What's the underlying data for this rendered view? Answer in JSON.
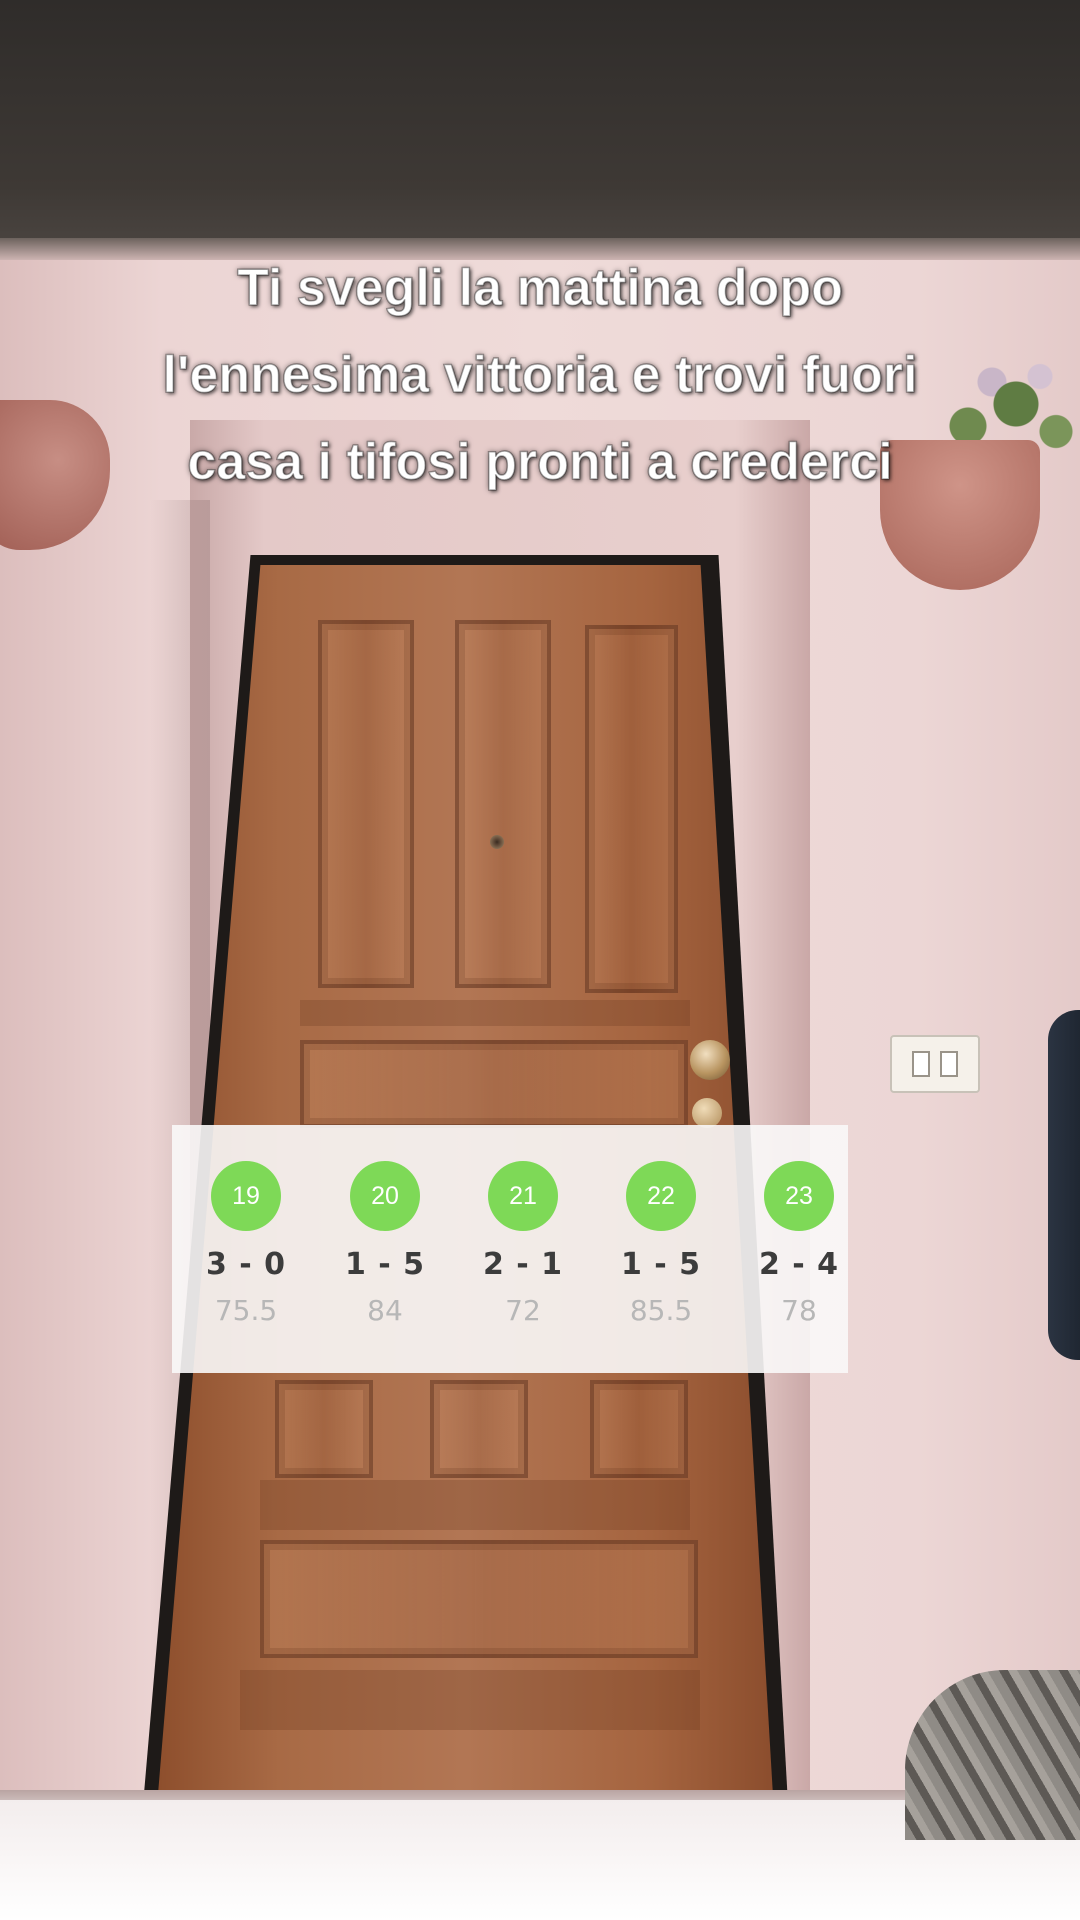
{
  "caption": {
    "lines": [
      "Ti svegli la mattina dopo",
      "l'ennesima vittoria e trovi fuori",
      "casa i tifosi pronti a crederci"
    ]
  },
  "results": {
    "accent_color": "#7ed957",
    "matches": [
      {
        "round": "19",
        "score": "3 - 0",
        "points": "75.5"
      },
      {
        "round": "20",
        "score": "1 - 5",
        "points": "84"
      },
      {
        "round": "21",
        "score": "2 - 1",
        "points": "72"
      },
      {
        "round": "22",
        "score": "1 - 5",
        "points": "85.5"
      },
      {
        "round": "23",
        "score": "2 - 4",
        "points": "78"
      }
    ]
  }
}
